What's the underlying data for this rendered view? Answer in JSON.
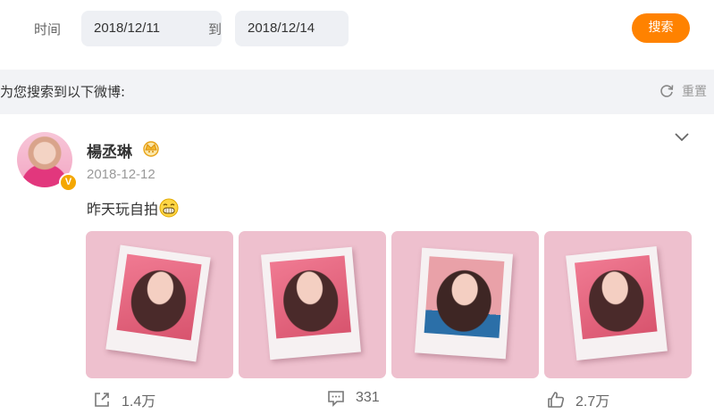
{
  "filter": {
    "time_label": "时间",
    "start_date": "2018/12/11",
    "to_label": "到",
    "end_date": "2018/12/14",
    "search_label": "搜索"
  },
  "results": {
    "title": "为您搜索到以下微博:",
    "reset_label": "重置"
  },
  "post": {
    "user_name": "楊丞琳",
    "verified_badge": "V",
    "date": "2018-12-12",
    "text": "昨天玩自拍",
    "images": [
      {
        "name": "selfie-photo-1"
      },
      {
        "name": "selfie-photo-2"
      },
      {
        "name": "selfie-photo-3"
      },
      {
        "name": "selfie-photo-4"
      }
    ],
    "actions": {
      "reposts": "1.4万",
      "comments": "331",
      "likes": "2.7万"
    }
  },
  "colors": {
    "accent": "#ff8200",
    "header_bg": "#f2f3f6",
    "input_bg": "#eef0f4"
  },
  "icons": [
    "refresh-icon",
    "crown-icon",
    "chevron-down-icon",
    "grin-emoji-icon",
    "share-icon",
    "comment-icon",
    "like-icon"
  ]
}
